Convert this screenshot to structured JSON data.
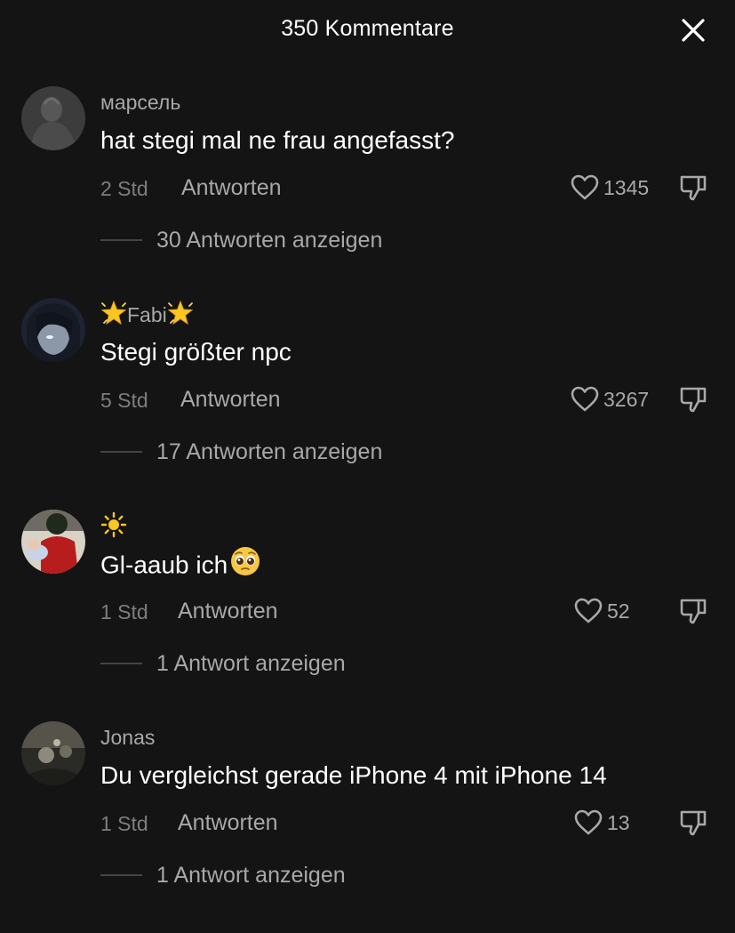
{
  "header": {
    "title": "350 Kommentare",
    "close_icon": "close-icon"
  },
  "colors": {
    "background": "#141414",
    "primary_text": "#ffffff",
    "secondary_text": "#a8a8a8",
    "muted_text": "#7d7d7d"
  },
  "comments": [
    {
      "username": "марсель",
      "text": "hat stegi mal ne frau angefasst?",
      "time": "2 Std",
      "reply_label": "Antworten",
      "likes": "1345",
      "replies_label": "30 Antworten anzeigen"
    },
    {
      "username": "Fabi",
      "username_emoji": "glowing-star-emoji",
      "text": "Stegi größter npc",
      "time": "5 Std",
      "reply_label": "Antworten",
      "likes": "3267",
      "replies_label": "17 Antworten anzeigen"
    },
    {
      "username": "",
      "username_emoji": "sun-emoji",
      "text": "Gl-aaub ich",
      "text_emoji": "pleading-face-emoji",
      "time": "1 Std",
      "reply_label": "Antworten",
      "likes": "52",
      "replies_label": "1 Antwort anzeigen"
    },
    {
      "username": "Jonas",
      "text": "Du vergleichst gerade iPhone 4 mit iPhone 14",
      "time": "1 Std",
      "reply_label": "Antworten",
      "likes": "13",
      "replies_label": "1 Antwort anzeigen"
    }
  ]
}
